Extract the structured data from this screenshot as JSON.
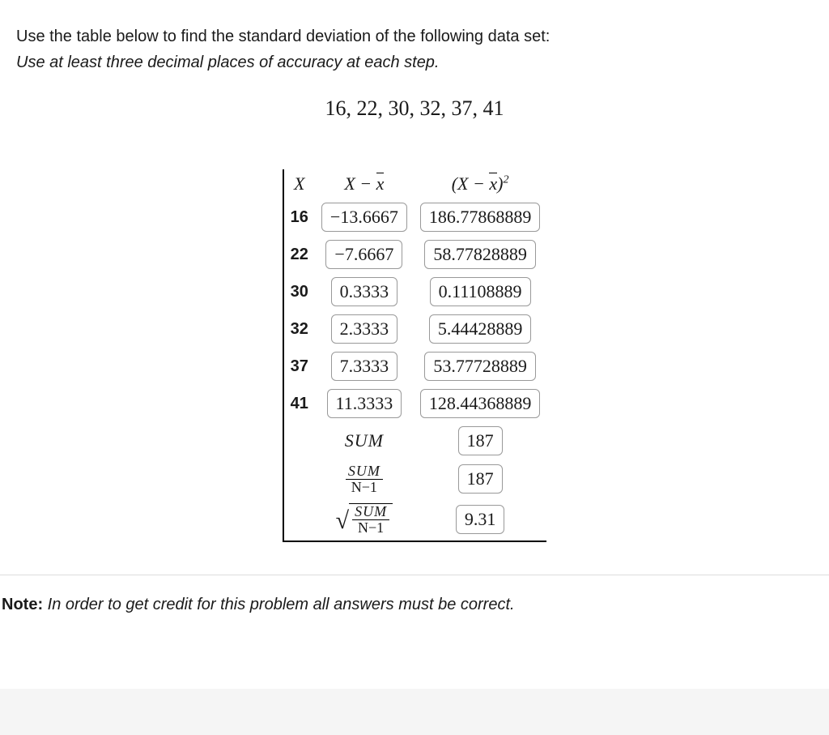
{
  "instructions": "Use the table below to find the standard deviation of the following data set:",
  "sub_instructions": "Use at least three decimal places of accuracy at each step.",
  "dataset": "16, 22, 30, 32, 37, 41",
  "headers": {
    "x": "X",
    "xminusxbar_prefix": "X − ",
    "xbar": "x",
    "sq_prefix": "(X − ",
    "sq_suffix": ")",
    "sq_exp": "2"
  },
  "rows": [
    {
      "x": "16",
      "dev": "−13.6667",
      "sq": "186.77868889"
    },
    {
      "x": "22",
      "dev": "−7.6667",
      "sq": "58.77828889"
    },
    {
      "x": "30",
      "dev": "0.3333",
      "sq": "0.11108889"
    },
    {
      "x": "32",
      "dev": "2.3333",
      "sq": "5.44428889"
    },
    {
      "x": "37",
      "dev": "7.3333",
      "sq": "53.77728889"
    },
    {
      "x": "41",
      "dev": "11.3333",
      "sq": "128.44368889"
    }
  ],
  "summary": {
    "sum_label": "SUM",
    "sum_value": "187",
    "frac_num": "SUM",
    "frac_den": "N−1",
    "frac_value": "187",
    "sqrt_num": "SUM",
    "sqrt_den": "N−1",
    "sqrt_value": "9.31"
  },
  "note": {
    "bold": "Note:",
    "text": " In order to get credit for this problem all answers must be correct."
  }
}
